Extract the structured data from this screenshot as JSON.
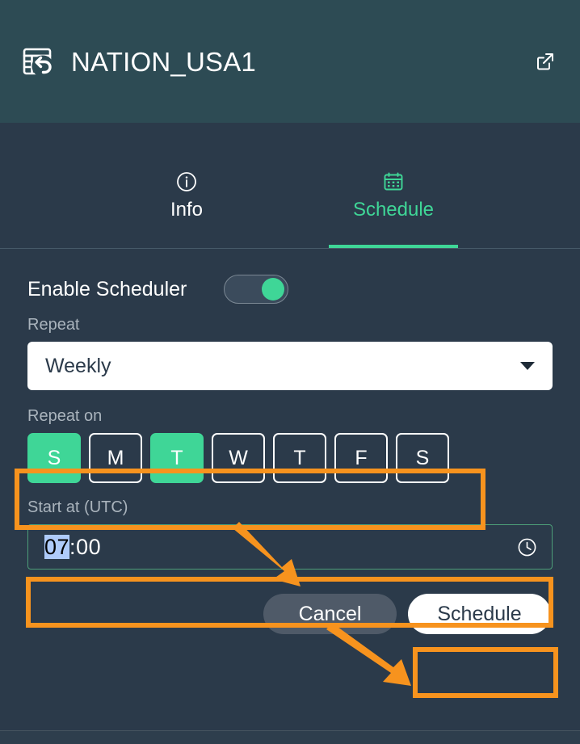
{
  "header": {
    "title": "NATION_USA1",
    "icon": "restore-table-icon",
    "action_icon": "external-link-icon"
  },
  "tabs": [
    {
      "label": "Info",
      "icon": "info-circle-icon",
      "active": false
    },
    {
      "label": "Schedule",
      "icon": "calendar-icon",
      "active": true
    }
  ],
  "form": {
    "enable_scheduler_label": "Enable Scheduler",
    "enable_scheduler_on": true,
    "repeat_label": "Repeat",
    "repeat_value": "Weekly",
    "repeat_caret_icon": "chevron-down-icon",
    "repeat_on_label": "Repeat on",
    "days": [
      {
        "label": "S",
        "selected": true
      },
      {
        "label": "M",
        "selected": false
      },
      {
        "label": "T",
        "selected": true
      },
      {
        "label": "W",
        "selected": false
      },
      {
        "label": "T",
        "selected": false
      },
      {
        "label": "F",
        "selected": false
      },
      {
        "label": "S",
        "selected": false
      }
    ],
    "start_at_label": "Start at (UTC)",
    "start_at_hours": "07",
    "start_at_separator": ":",
    "start_at_minutes": "00",
    "clock_icon": "clock-icon"
  },
  "actions": {
    "cancel_label": "Cancel",
    "schedule_label": "Schedule"
  },
  "colors": {
    "header_bg": "#2d4b54",
    "panel_bg": "#2b3a4a",
    "accent_green": "#3fd697",
    "annotation_orange": "#f7931e",
    "selection_blue": "#aecbfa",
    "muted_label": "#aab4bd"
  }
}
